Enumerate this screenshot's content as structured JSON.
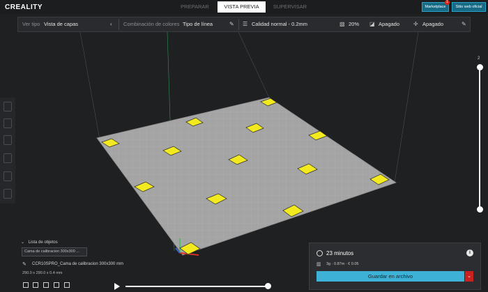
{
  "app": {
    "logo": "CREALITY"
  },
  "header": {
    "tabs": [
      {
        "label": "PREPARAR"
      },
      {
        "label": "VISTA PREVIA"
      },
      {
        "label": "SUPERVISAR"
      }
    ],
    "marketplace_label": "Marketplace",
    "marketplace_badge": "1",
    "website_label": "Sitio web oficial"
  },
  "toolbar": {
    "view_type_label": "Ver tipo",
    "view_type_value": "Vista de capas",
    "color_scheme_label": "Combinación de colores",
    "color_scheme_value": "Tipo de línea",
    "profile_value": "Calidad normal - 0.2mm",
    "infill_value": "20%",
    "support_value": "Apagado",
    "adhesion_value": "Apagado"
  },
  "layer_slider": {
    "top_value": "2"
  },
  "objects": {
    "list_title": "Lista de objetos",
    "selected_object": "Cama de calibracion 300x300 ...",
    "object_name": "CCR10SPRO_Cama de calibracion 300x300 mm",
    "dimensions": "290.0 x 290.0 x 0.4 mm"
  },
  "print_info": {
    "time": "23 minutos",
    "stats": "3g · 0.87m · € 0.05",
    "save_label": "Guardar en archivo",
    "info_icon": "i"
  },
  "colors": {
    "accent": "#3db1d6",
    "bed": "#a3a3a3",
    "pad": "#f2ea1e",
    "danger": "#c92020"
  }
}
